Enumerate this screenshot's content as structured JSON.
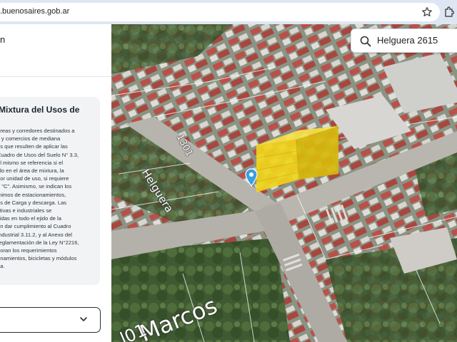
{
  "browser": {
    "url": ".buenosaires.gob.ar",
    "icons": [
      "star-icon",
      "extension-icon"
    ]
  },
  "panel": {
    "header_partial": "n",
    "card": {
      "title_lines": [
        "Mixtura del Usos de",
        ""
      ],
      "body_lines": [
        "áreas y corredores destinados a",
        "s y comercios de mediana",
        "es que resulten de aplicar las",
        "Cuadro de Usos del Suelo N° 3.3,",
        "el mismo se referencia si el",
        "ido en el área de mixtura, la",
        "por unidad de uso, si requiere",
        "o \"C\". Asimismo, se indican los",
        "ínimos de estacionamientos,",
        "os de Carga y descarga. Las",
        "ctivas e industriales se",
        "itidas en todo el ejido de la",
        "en dar cumplimiento al Cuadro",
        "Industrial 3.11.2, y al Anexo del",
        "reglamentación de la Ley N°2216,",
        "poran los requerimientos",
        "onamientos, bicicletas y módulos",
        "ga."
      ]
    },
    "dropdown": {
      "value": "",
      "icon": "chevron-down-icon"
    }
  },
  "map": {
    "search": {
      "value": "Helguera 2615",
      "icon": "search-icon"
    },
    "street_labels": {
      "helguera": "Helguera",
      "number": "1301",
      "marcos": "Marcos",
      "marcos_prefix": "l01"
    },
    "highlight_color": "#f2d41a",
    "pin_color": "#3aa0e0"
  }
}
